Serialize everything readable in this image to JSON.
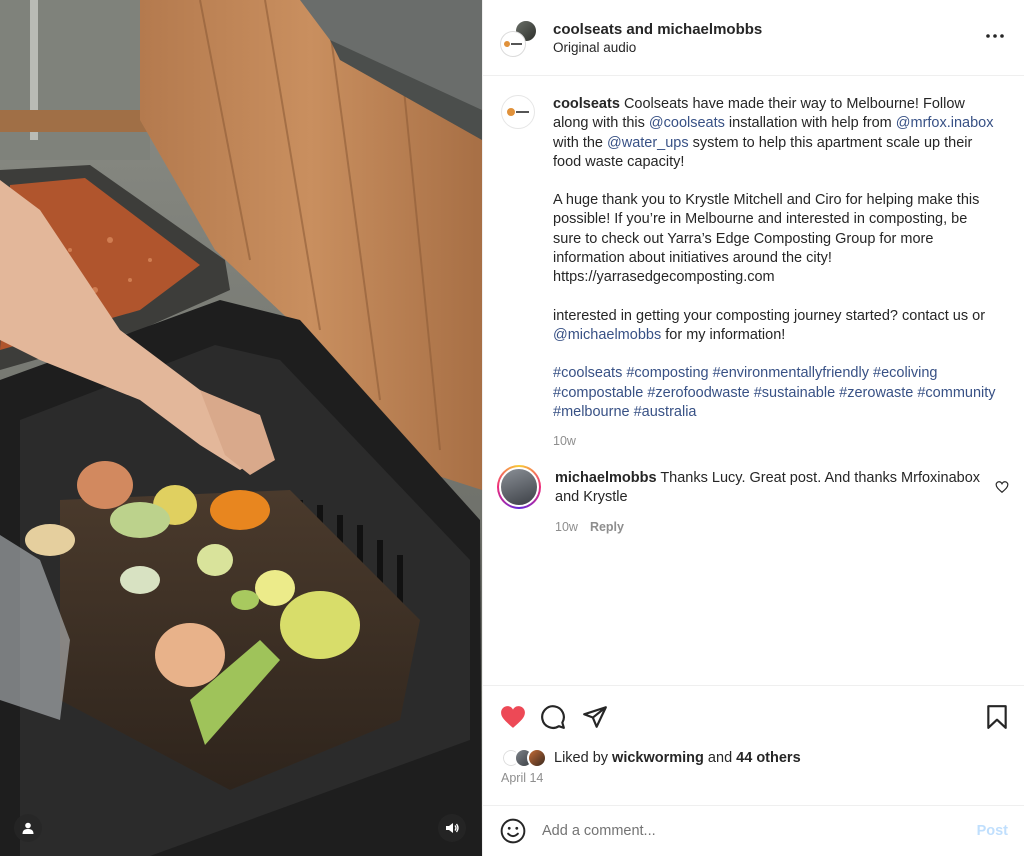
{
  "header": {
    "title": "coolseats and michaelmobbs",
    "subtitle": "Original audio",
    "brand_logo_text": "COOLSEATS"
  },
  "caption": {
    "username": "coolseats",
    "p1": {
      "t1": "Coolseats have made their way to Melbourne! Follow along with this ",
      "m1": "@coolseats",
      "t2": " installation with help from ",
      "m2": "@mrfox.inabox",
      "t3": " with the ",
      "m3": "@water_ups",
      "t4": " system to help this apartment scale up their food waste capacity!"
    },
    "p2": "A huge thank you to Krystle Mitchell and Ciro for helping make this possible! If you’re in Melbourne and interested in composting, be sure to check out Yarra’s Edge Composting Group for more information about initiatives around the city! https://yarrasedgecomposting.com",
    "p3": {
      "t1": "interested in getting your composting journey started? contact us or ",
      "m1": "@michaelmobbs",
      "t2": " for my information!"
    },
    "hashtags": [
      "#coolseats",
      "#composting",
      "#environmentallyfriendly",
      "#ecoliving",
      "#compostable",
      "#zerofoodwaste",
      "#sustainable",
      "#zerowaste",
      "#community",
      "#melbourne",
      "#australia"
    ],
    "age": "10w"
  },
  "comment": {
    "username": "michaelmobbs",
    "text": "Thanks Lucy. Great post. And thanks Mrfoxinabox and Krystle",
    "age": "10w",
    "reply_label": "Reply"
  },
  "likes": {
    "prefix": "Liked by ",
    "user": "wickworming",
    "and": " and ",
    "others": "44 others",
    "liked": true,
    "like_color": "#ed4956"
  },
  "date": "April 14",
  "composer": {
    "placeholder": "Add a comment...",
    "post_label": "Post"
  },
  "icons": {
    "more": "more-options-icon",
    "like": "heart-icon",
    "comment": "comment-icon",
    "share": "share-icon",
    "save": "bookmark-icon",
    "emoji": "emoji-icon",
    "tags": "user-tag-icon",
    "audio": "volume-icon"
  },
  "colors": {
    "link": "#385185",
    "muted": "#8e8e8e",
    "post_disabled": "#c0dffd"
  }
}
